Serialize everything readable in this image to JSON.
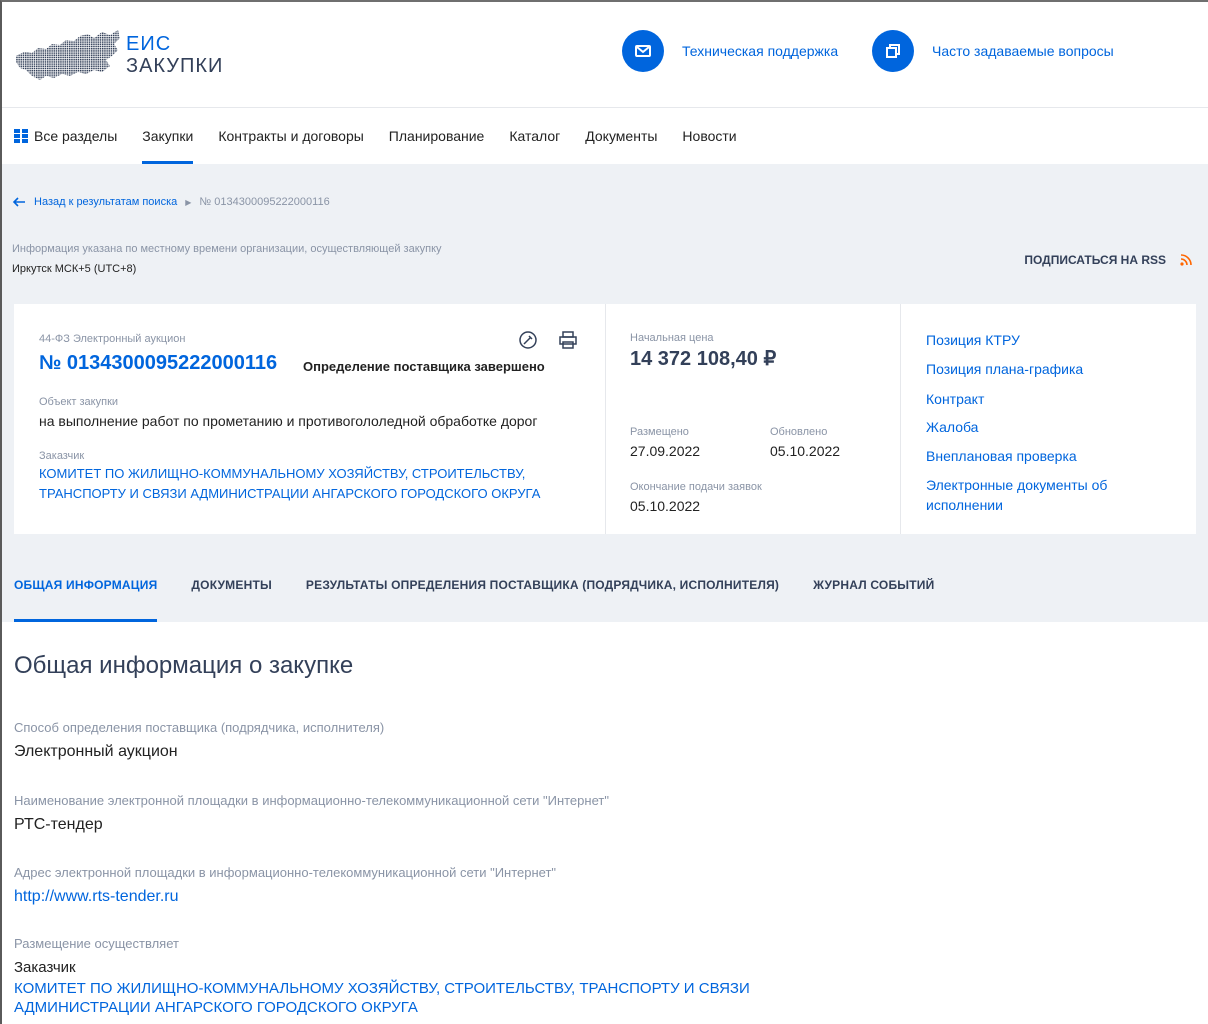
{
  "header": {
    "logo_line1": "ЕИС",
    "logo_line2": "ЗАКУПКИ",
    "support_label": "Техническая поддержка",
    "faq_label": "Часто задаваемые вопросы"
  },
  "nav": {
    "items": [
      {
        "label": "Все разделы"
      },
      {
        "label": "Закупки"
      },
      {
        "label": "Контракты и договоры"
      },
      {
        "label": "Планирование"
      },
      {
        "label": "Каталог"
      },
      {
        "label": "Документы"
      },
      {
        "label": "Новости"
      }
    ],
    "active": "Закупки"
  },
  "breadcrumb": {
    "back_label": "Назад к результатам поиска",
    "current": "№ 0134300095222000116"
  },
  "timezone": {
    "info": "Информация указана по местному времени организации, осуществляющей закупку",
    "value": "Иркутск МСК+5 (UTC+8)"
  },
  "rss_label": "ПОДПИСАТЬСЯ НА RSS",
  "card": {
    "law_type": "44-ФЗ Электронный аукцион",
    "reg_number": "№ 0134300095222000116",
    "status": "Определение поставщика завершено",
    "object_label": "Объект закупки",
    "object_value": "на выполнение работ по прометанию и противогололедной обработке дорог",
    "customer_label": "Заказчик",
    "customer_value": "КОМИТЕТ ПО ЖИЛИЩНО-КОММУНАЛЬНОМУ ХОЗЯЙСТВУ, СТРОИТЕЛЬСТВУ, ТРАНСПОРТУ И СВЯЗИ АДМИНИСТРАЦИИ АНГАРСКОГО ГОРОДСКОГО ОКРУГА",
    "price_label": "Начальная цена",
    "price_value": "14 372 108,40 ₽",
    "posted_label": "Размещено",
    "posted_value": "27.09.2022",
    "updated_label": "Обновлено",
    "updated_value": "05.10.2022",
    "deadline_label": "Окончание подачи заявок",
    "deadline_value": "05.10.2022",
    "links": [
      "Позиция КТРУ",
      "Позиция плана-графика",
      "Контракт",
      "Жалоба",
      "Внеплановая проверка",
      "Электронные документы об исполнении"
    ]
  },
  "tabs": [
    {
      "label": "ОБЩАЯ ИНФОРМАЦИЯ"
    },
    {
      "label": "ДОКУМЕНТЫ"
    },
    {
      "label": "РЕЗУЛЬТАТЫ ОПРЕДЕЛЕНИЯ ПОСТАВЩИКА (ПОДРЯДЧИКА, ИСПОЛНИТЕЛЯ)"
    },
    {
      "label": "ЖУРНАЛ СОБЫТИЙ"
    }
  ],
  "active_tab": "ОБЩАЯ ИНФОРМАЦИЯ",
  "general": {
    "title": "Общая информация о закупке",
    "method_label": "Способ определения поставщика (подрядчика, исполнителя)",
    "method_value": "Электронный аукцион",
    "platform_label": "Наименование электронной площадки в информационно-телекоммуникационной сети \"Интернет\"",
    "platform_value": "РТС-тендер",
    "address_label": "Адрес электронной площадки в информационно-телекоммуникационной сети \"Интернет\"",
    "address_value": "http://www.rts-tender.ru",
    "placement_label": "Размещение осуществляет",
    "placement_role": "Заказчик",
    "placement_org": "КОМИТЕТ ПО ЖИЛИЩНО-КОММУНАЛЬНОМУ ХОЗЯЙСТВУ, СТРОИТЕЛЬСТВУ, ТРАНСПОРТУ И СВЯЗИ АДМИНИСТРАЦИИ АНГАРСКОГО ГОРОДСКОГО ОКРУГА"
  },
  "colors": {
    "accent": "#0065dd",
    "text": "#222222",
    "muted": "#8a94a6",
    "background_gray": "#eef1f5",
    "rss": "#ff6600"
  },
  "icons": [
    "russia-map-logo-icon",
    "envelope-icon",
    "copy-icon",
    "grid-icon",
    "arrow-left-icon",
    "chevron-right-icon",
    "signature-icon",
    "print-icon",
    "rss-icon"
  ]
}
